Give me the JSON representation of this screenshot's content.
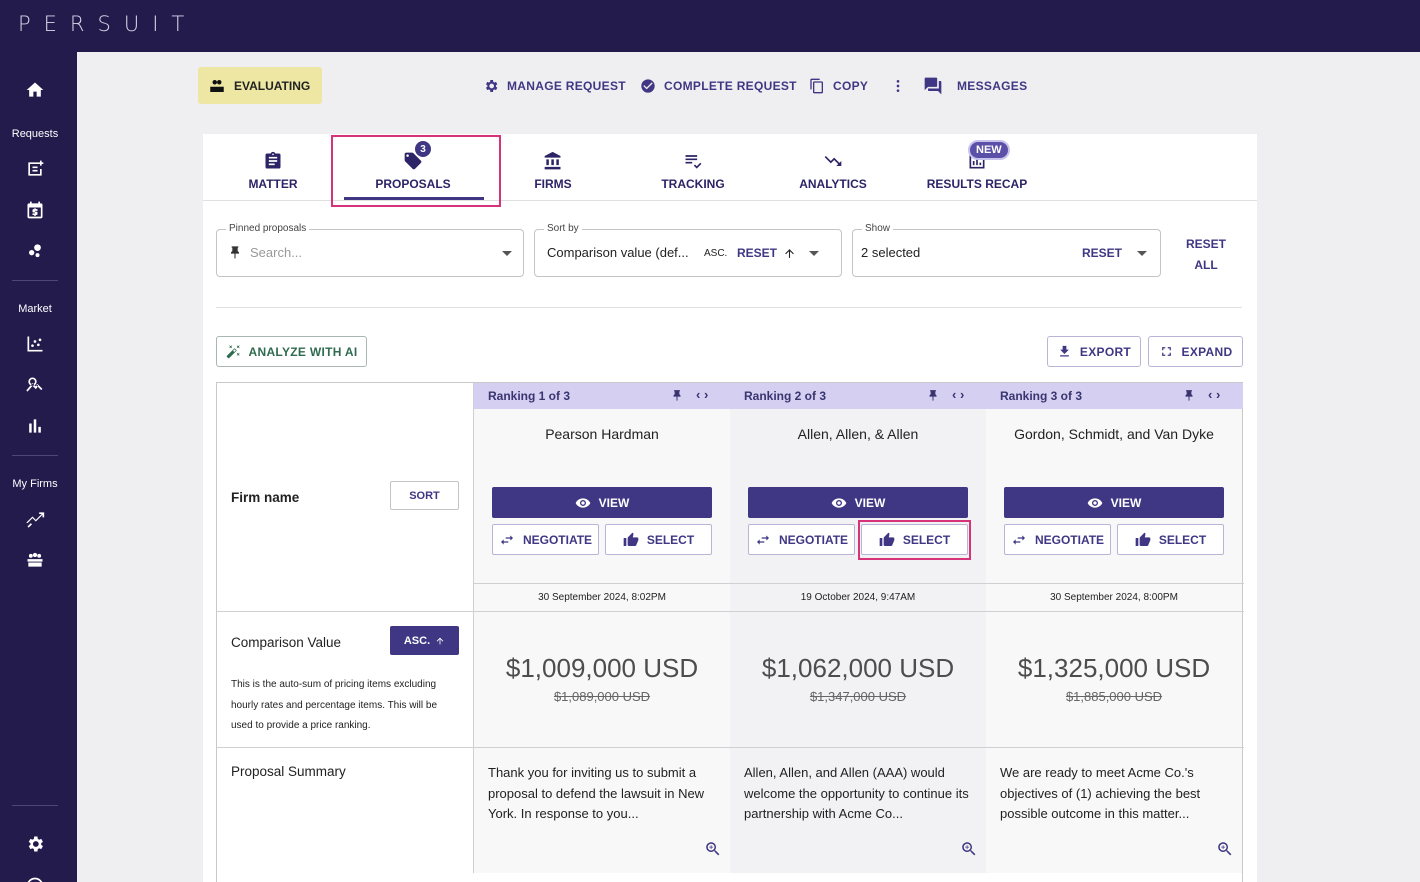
{
  "app": {
    "logo": "PERSUIT"
  },
  "sidebar": {
    "sections": {
      "requests": "Requests",
      "market": "Market",
      "my_firms": "My Firms"
    }
  },
  "actions": {
    "status": "EVALUATING",
    "manage": "MANAGE REQUEST",
    "complete": "COMPLETE REQUEST",
    "copy": "COPY",
    "messages": "MESSAGES"
  },
  "tabs": [
    {
      "label": "MATTER"
    },
    {
      "label": "PROPOSALS",
      "badge": "3",
      "active": true
    },
    {
      "label": "FIRMS"
    },
    {
      "label": "TRACKING"
    },
    {
      "label": "ANALYTICS"
    },
    {
      "label": "RESULTS RECAP",
      "badge": "NEW"
    }
  ],
  "filters": {
    "pinned": {
      "label": "Pinned proposals",
      "placeholder": "Search..."
    },
    "sort": {
      "label": "Sort by",
      "value": "Comparison value (def...",
      "order": "ASC.",
      "reset": "RESET"
    },
    "show": {
      "label": "Show",
      "value": "2 selected",
      "reset": "RESET"
    },
    "reset_all_1": "RESET",
    "reset_all_2": "ALL"
  },
  "toolbar": {
    "analyze": "ANALYZE WITH AI",
    "export": "EXPORT",
    "expand": "EXPAND"
  },
  "rows": {
    "firm_name": {
      "title": "Firm name",
      "button": "SORT"
    },
    "comparison": {
      "title": "Comparison Value",
      "button": "ASC.",
      "description": "This is the auto-sum of pricing items excluding hourly rates and percentage items. This will be used to provide a price ranking."
    },
    "summary": {
      "title": "Proposal Summary"
    }
  },
  "buttons": {
    "view": "VIEW",
    "negotiate": "NEGOTIATE",
    "select": "SELECT"
  },
  "proposals": [
    {
      "ranking": "Ranking 1 of 3",
      "firm": "Pearson Hardman",
      "date": "30 September 2024, 8:02PM",
      "price": "$1,009,000 USD",
      "old_price": "$1,089,000 USD",
      "summary": "Thank you for inviting us to submit a proposal to defend the lawsuit in New York. In response to you..."
    },
    {
      "ranking": "Ranking 2 of 3",
      "firm": "Allen, Allen, & Allen",
      "date": "19 October 2024, 9:47AM",
      "price": "$1,062,000 USD",
      "old_price": "$1,347,000 USD",
      "summary": "Allen, Allen, and Allen (AAA) would welcome the opportunity to continue its partnership with Acme Co..."
    },
    {
      "ranking": "Ranking 3 of 3",
      "firm": "Gordon, Schmidt, and Van Dyke",
      "date": "30 September 2024, 8:00PM",
      "price": "$1,325,000 USD",
      "old_price": "$1,885,000 USD",
      "summary": "We are ready to meet Acme Co.'s objectives of (1) achieving the best possible outcome in this matter..."
    }
  ],
  "colors": {
    "brand_dark": "#241b4d",
    "accent": "#3f3783",
    "highlight": "#d6337a",
    "status_chip": "#ede7a3",
    "column_header": "#d5d0f2"
  }
}
